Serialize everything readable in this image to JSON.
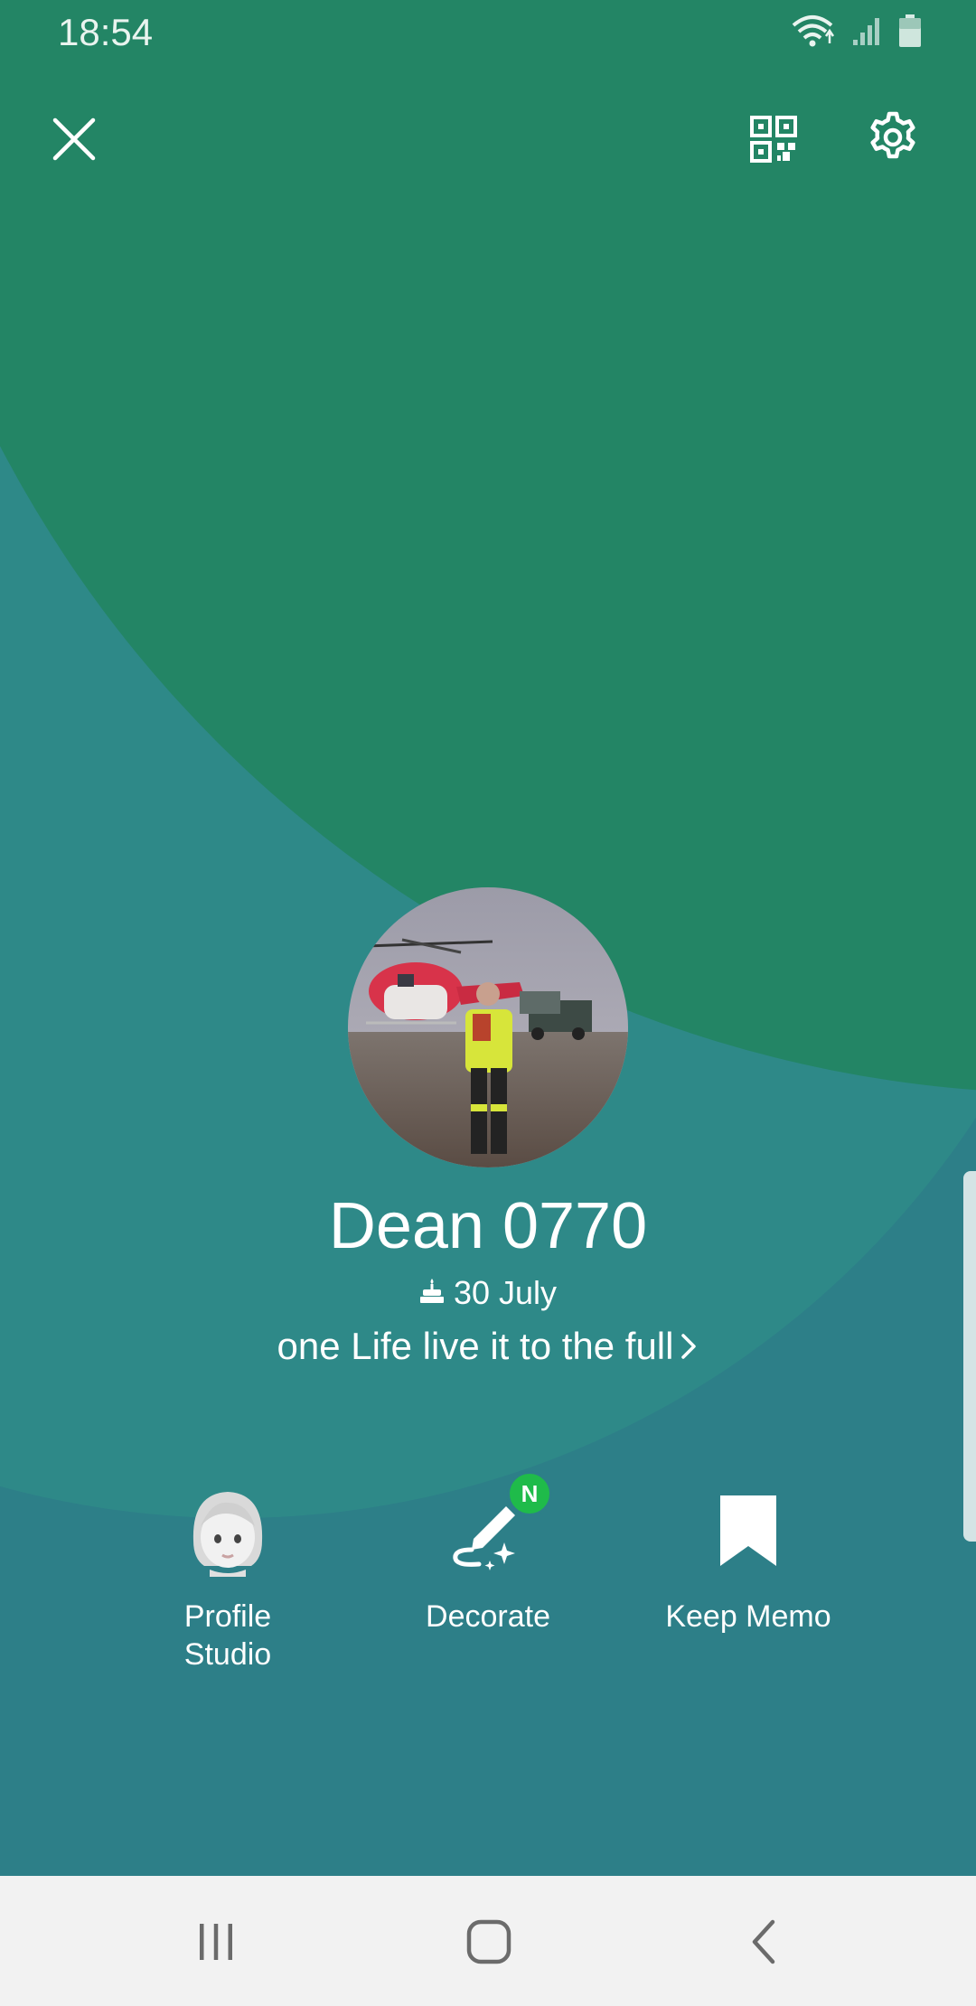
{
  "status_bar": {
    "time": "18:54",
    "icons": [
      "wifi-icon",
      "signal-icon",
      "battery-icon"
    ]
  },
  "toolbar": {
    "close_icon": "close-icon",
    "qr_icon": "qr-code-icon",
    "settings_icon": "gear-icon"
  },
  "profile": {
    "name": "Dean 0770",
    "birthday": "30 July",
    "status_message": "one Life live it to the full"
  },
  "actions": [
    {
      "label": "Profile\nStudio",
      "icon": "avatar-face-icon"
    },
    {
      "label": "Decorate",
      "icon": "pen-sparkle-icon",
      "badge": "N"
    },
    {
      "label": "Keep Memo",
      "icon": "bookmark-icon"
    }
  ],
  "nav": {
    "recents_icon": "recents-icon",
    "home_icon": "home-icon",
    "back_icon": "back-icon"
  },
  "colors": {
    "background_teal": "#2d7f88",
    "background_green": "#238565",
    "badge_green": "#1fbb4a",
    "nav_bar": "#f2f2f2"
  }
}
